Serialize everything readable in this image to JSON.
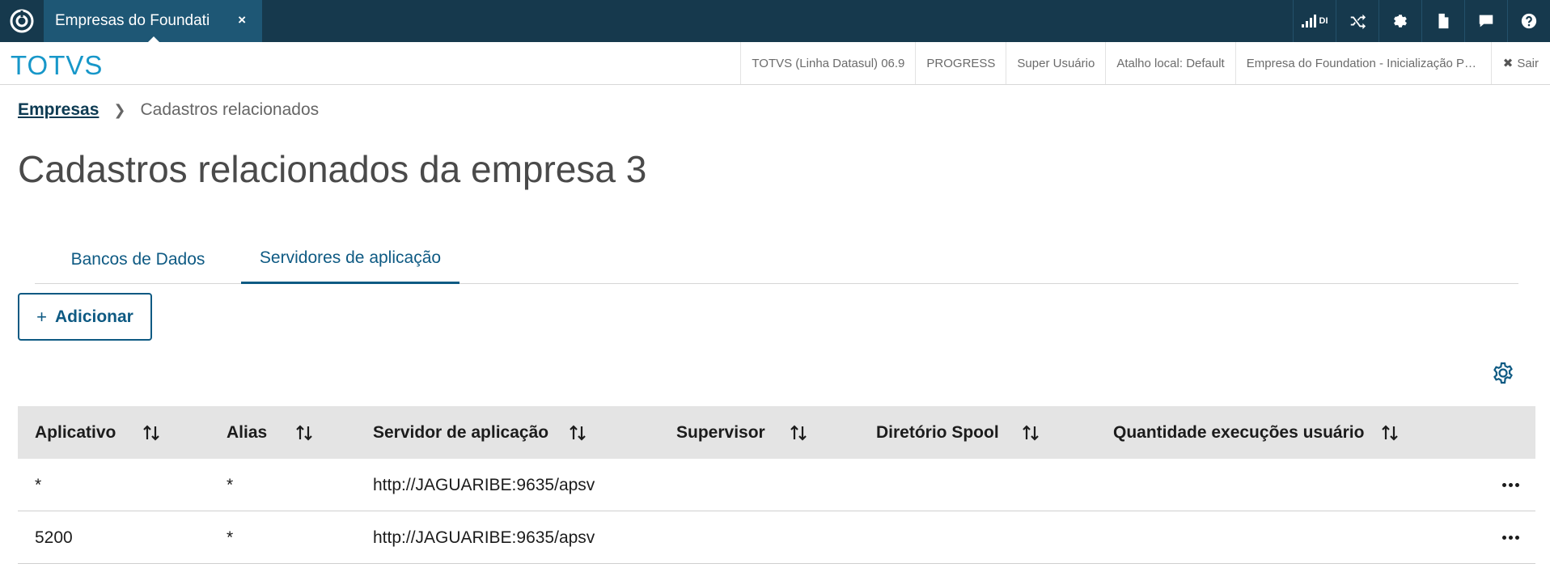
{
  "topbar": {
    "tab_title": "Empresas do Foundation",
    "tab_close": "×",
    "signal_label": "DI",
    "icons": [
      "signal-icon",
      "shuffle-icon",
      "gear-icon",
      "document-icon",
      "chat-icon",
      "help-icon"
    ]
  },
  "header": {
    "brand": "TOTVS",
    "version": "TOTVS (Linha Datasul) 06.9",
    "database": "PROGRESS",
    "user": "Super Usuário",
    "shortcut": "Atalho local: Default",
    "company": "Empresa do Foundation - Inicialização Pr ...",
    "logout": "Sair"
  },
  "breadcrumb": {
    "root": "Empresas",
    "current": "Cadastros relacionados"
  },
  "page": {
    "title": "Cadastros relacionados da empresa 3"
  },
  "tabs": [
    {
      "label": "Bancos de Dados",
      "active": false
    },
    {
      "label": "Servidores de aplicação",
      "active": true
    }
  ],
  "actions": {
    "add_label": "Adicionar"
  },
  "table": {
    "columns": [
      "Aplicativo",
      "Alias",
      "Servidor de aplicação",
      "Supervisor",
      "Diretório Spool",
      "Quantidade execuções usuário"
    ],
    "rows": [
      [
        "*",
        "*",
        "http://JAGUARIBE:9635/apsv",
        "",
        "",
        ""
      ],
      [
        "5200",
        "*",
        "http://JAGUARIBE:9635/apsv",
        "",
        "",
        ""
      ]
    ]
  },
  "colors": {
    "topbar": "#16394d",
    "active_tab": "#1e5775",
    "brand": "#1797c9",
    "primary": "#0e5a83",
    "header_bg": "#e4e4e4"
  }
}
